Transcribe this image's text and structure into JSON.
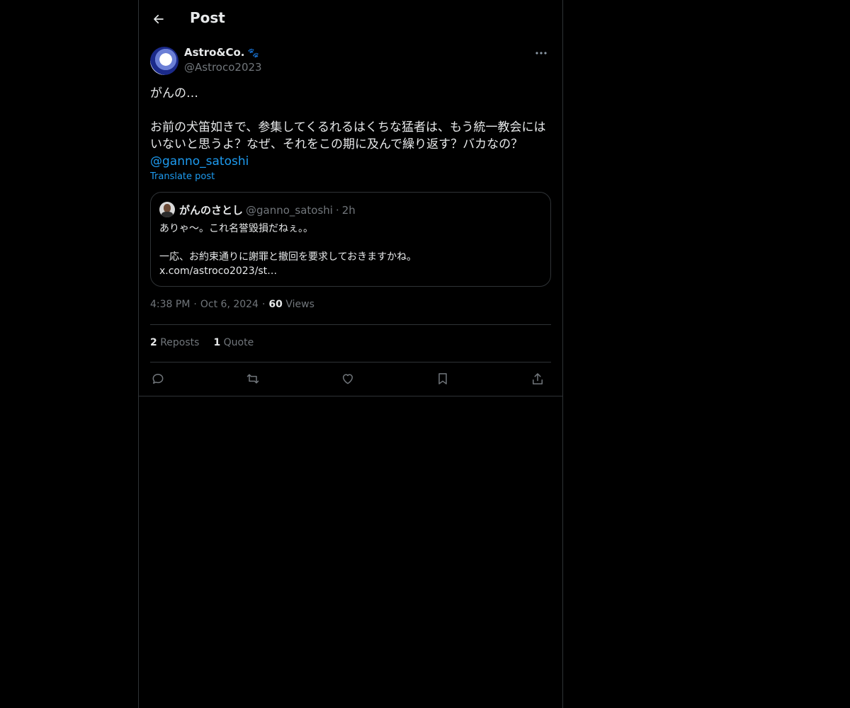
{
  "header": {
    "title": "Post"
  },
  "author": {
    "display_name": "Astro&Co.",
    "badge": "🐾",
    "handle": "@Astroco2023"
  },
  "post": {
    "text": "がんの…\n\nお前の犬笛如きで、参集してくるれるはくちな猛者は、もう統一教会にはいないと思うよ？なぜ、それをこの期に及んで繰り返す？バカなの？\n",
    "mention": "@ganno_satoshi",
    "translate_label": "Translate post"
  },
  "quote": {
    "name": "がんのさとし",
    "handle": "@ganno_satoshi",
    "separator": "·",
    "time": "2h",
    "text": "ありゃ〜。これ名誉毀損だねぇ。。\n\n一応、お約束通りに謝罪と撤回を要求しておきますかね。\nx.com/astroco2023/st…"
  },
  "meta": {
    "time": "4:38 PM",
    "date": "Oct 6, 2024",
    "views_count": "60",
    "views_label": "Views",
    "dot": "·"
  },
  "stats": {
    "reposts_count": "2",
    "reposts_label": "Reposts",
    "quotes_count": "1",
    "quotes_label": "Quote"
  },
  "icons": {
    "back": "arrow-left-icon",
    "more": "more-horizontal-icon",
    "reply": "reply-icon",
    "repost": "repost-icon",
    "like": "heart-icon",
    "bookmark": "bookmark-icon",
    "share": "share-icon"
  },
  "colors": {
    "background": "#000000",
    "text": "#e7e9ea",
    "secondary": "#71767b",
    "link": "#1d9bf0",
    "border": "#2f3336"
  }
}
